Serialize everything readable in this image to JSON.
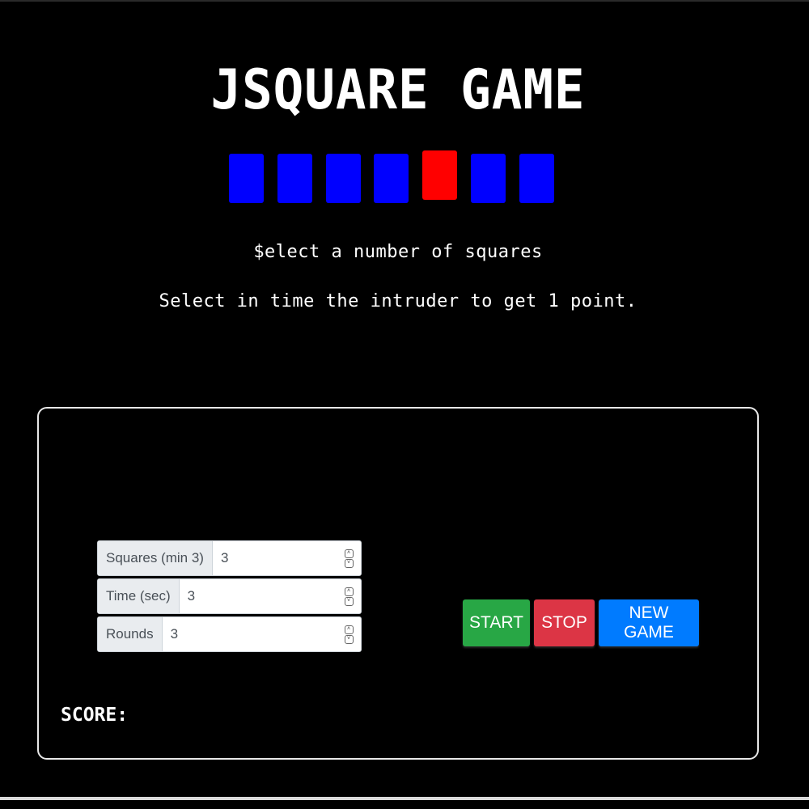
{
  "header": {
    "title": "JSQUARE GAME"
  },
  "squares": [
    {
      "color": "#0000ff",
      "intruder": false
    },
    {
      "color": "#0000ff",
      "intruder": false
    },
    {
      "color": "#0000ff",
      "intruder": false
    },
    {
      "color": "#0000ff",
      "intruder": false
    },
    {
      "color": "#ff0000",
      "intruder": true
    },
    {
      "color": "#0000ff",
      "intruder": false
    },
    {
      "color": "#0000ff",
      "intruder": false
    }
  ],
  "instructions": {
    "line1": "$elect a number of squares",
    "line2": "Select in time the intruder to get 1 point."
  },
  "settings": {
    "squares_label": "Squares (min 3)",
    "squares_value": "3",
    "time_label": "Time (sec)",
    "time_value": "3",
    "rounds_label": "Rounds",
    "rounds_value": "3"
  },
  "controls": {
    "start_label": "START",
    "start_color": "#28a745",
    "stop_label": "STOP",
    "stop_color": "#dc3545",
    "new_game_label": "NEW GAME",
    "new_game_color": "#007bff"
  },
  "score": {
    "label": "SCORE:"
  }
}
